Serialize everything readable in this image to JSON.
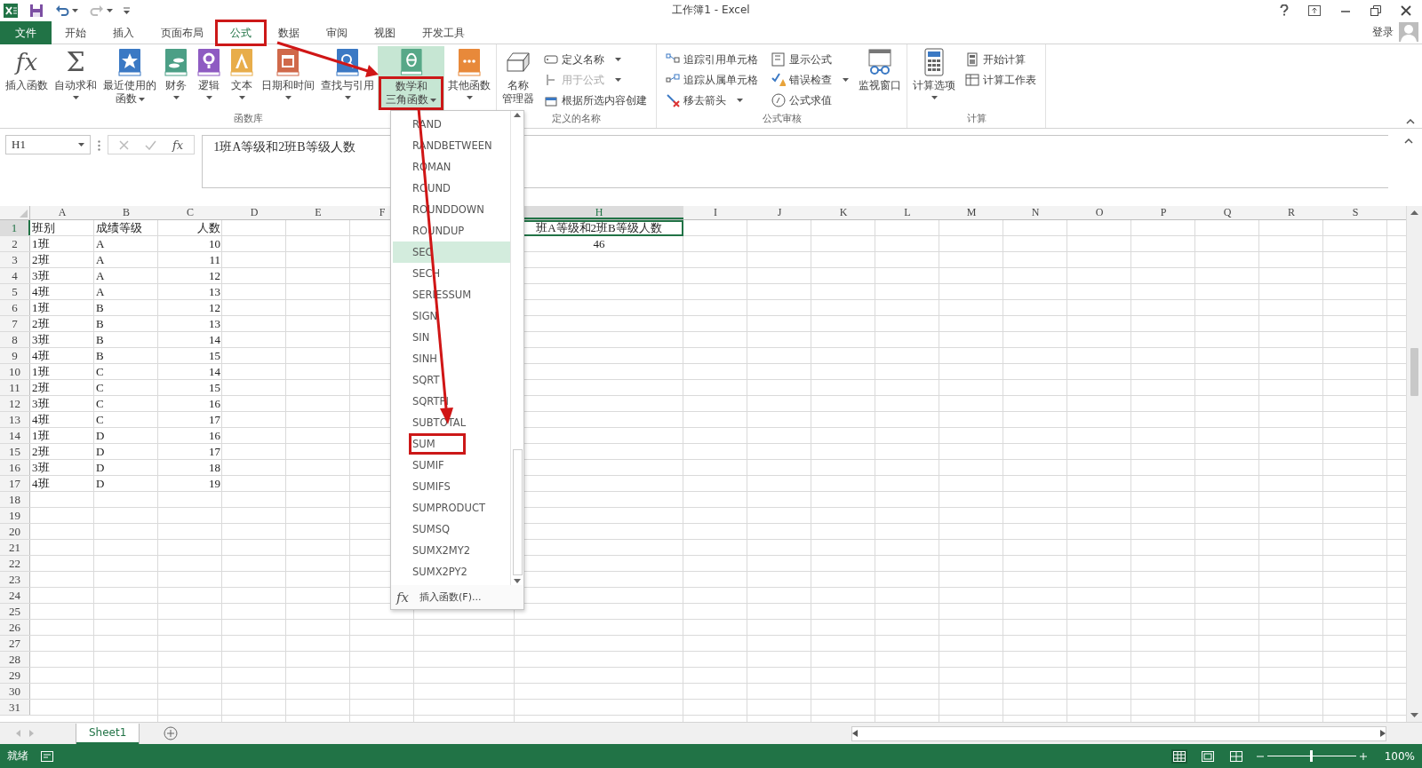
{
  "title_bar": {
    "title": "工作簿1 - Excel",
    "redo": {
      "disabled": true
    }
  },
  "tabs": [
    {
      "label": "文件",
      "kind": "file",
      "selected": false,
      "annotated": false
    },
    {
      "label": "开始",
      "kind": "tab",
      "selected": false,
      "annotated": false
    },
    {
      "label": "插入",
      "kind": "tab",
      "selected": false,
      "annotated": false
    },
    {
      "label": "页面布局",
      "kind": "tab",
      "selected": false,
      "annotated": false
    },
    {
      "label": "公式",
      "kind": "tab",
      "selected": true,
      "annotated": true
    },
    {
      "label": "数据",
      "kind": "tab",
      "selected": false,
      "annotated": false
    },
    {
      "label": "审阅",
      "kind": "tab",
      "selected": false,
      "annotated": false
    },
    {
      "label": "视图",
      "kind": "tab",
      "selected": false,
      "annotated": false
    },
    {
      "label": "开发工具",
      "kind": "tab",
      "selected": false,
      "annotated": false
    }
  ],
  "account": {
    "label": "登录"
  },
  "ribbon": {
    "groups": [
      {
        "label": "函数库",
        "items": [
          {
            "kind": "large",
            "icon_text": "fx",
            "lines": [
              "插入函数"
            ],
            "dropdown": false,
            "selected": false,
            "annotated": false
          },
          {
            "kind": "large",
            "icon_text": "Σ",
            "lines": [
              "自动求和"
            ],
            "dropdown": true,
            "selected": false,
            "annotated": false
          },
          {
            "kind": "large",
            "lines": [
              "最近使用的",
              "函数"
            ],
            "dropdown": true,
            "selected": false,
            "annotated": false
          },
          {
            "kind": "large",
            "lines": [
              "财务"
            ],
            "dropdown": true,
            "selected": false,
            "annotated": false
          },
          {
            "kind": "large",
            "lines": [
              "逻辑"
            ],
            "dropdown": true,
            "selected": false,
            "annotated": false
          },
          {
            "kind": "large",
            "lines": [
              "文本"
            ],
            "dropdown": true,
            "selected": false,
            "annotated": false
          },
          {
            "kind": "large",
            "lines": [
              "日期和时间"
            ],
            "dropdown": true,
            "selected": false,
            "annotated": false
          },
          {
            "kind": "large",
            "lines": [
              "查找与引用"
            ],
            "dropdown": true,
            "selected": false,
            "annotated": false
          },
          {
            "kind": "large",
            "lines": [
              "数学和",
              "三角函数"
            ],
            "dropdown": true,
            "selected": true,
            "annotated": true
          },
          {
            "kind": "large",
            "lines": [
              "其他函数"
            ],
            "dropdown": true,
            "selected": false,
            "annotated": false
          }
        ]
      },
      {
        "label": "定义的名称",
        "items": [
          {
            "kind": "large",
            "lines": [
              "名称",
              "管理器"
            ],
            "dropdown": false,
            "selected": false,
            "annotated": false
          },
          {
            "kind": "column",
            "items": [
              {
                "label": "定义名称",
                "dropdown": true,
                "disabled": false
              },
              {
                "label": "用于公式",
                "dropdown": true,
                "disabled": true
              },
              {
                "label": "根据所选内容创建",
                "dropdown": false,
                "disabled": false
              }
            ]
          }
        ]
      },
      {
        "label": "公式审核",
        "items": [
          {
            "kind": "column",
            "items": [
              {
                "label": "追踪引用单元格",
                "dropdown": false,
                "disabled": false
              },
              {
                "label": "追踪从属单元格",
                "dropdown": false,
                "disabled": false
              },
              {
                "label": "移去箭头",
                "dropdown": true,
                "disabled": false
              }
            ]
          },
          {
            "kind": "column",
            "items": [
              {
                "label": "显示公式",
                "dropdown": false,
                "disabled": false
              },
              {
                "label": "错误检查",
                "dropdown": true,
                "disabled": false
              },
              {
                "label": "公式求值",
                "dropdown": false,
                "disabled": false
              }
            ]
          },
          {
            "kind": "large",
            "lines": [
              "监视窗口"
            ],
            "dropdown": false,
            "selected": false,
            "annotated": false
          }
        ]
      },
      {
        "label": "计算",
        "items": [
          {
            "kind": "large",
            "lines": [
              "计算选项"
            ],
            "dropdown": true,
            "selected": false,
            "annotated": false
          },
          {
            "kind": "column",
            "items": [
              {
                "label": "开始计算",
                "dropdown": false,
                "disabled": false
              },
              {
                "label": "计算工作表",
                "dropdown": false,
                "disabled": false
              }
            ]
          }
        ]
      }
    ]
  },
  "formula_bar": {
    "name_box": "H1",
    "buttons_disabled": true,
    "fx": "fx",
    "formula": "1班A等级和2班B等级人数"
  },
  "grid": {
    "columns": [
      {
        "label": "A",
        "selected": false
      },
      {
        "label": "B",
        "selected": false
      },
      {
        "label": "C",
        "selected": false
      },
      {
        "label": "D",
        "selected": false
      },
      {
        "label": "E",
        "selected": false
      },
      {
        "label": "F",
        "selected": false
      },
      {},
      {
        "label": "H",
        "selected": true
      },
      {
        "label": "I",
        "selected": false
      },
      {
        "label": "J",
        "selected": false
      },
      {
        "label": "K",
        "selected": false
      },
      {
        "label": "L",
        "selected": false
      },
      {
        "label": "M",
        "selected": false
      },
      {
        "label": "N",
        "selected": false
      },
      {
        "label": "O",
        "selected": false
      },
      {
        "label": "P",
        "selected": false
      },
      {
        "label": "Q",
        "selected": false
      },
      {
        "label": "R",
        "selected": false
      },
      {
        "label": "S",
        "selected": false
      }
    ],
    "rows": [
      {
        "label": "1",
        "selected": true,
        "cells": [
          "班别",
          "成绩等级",
          "人数",
          null,
          null,
          null,
          null,
          "班A等级和2班B等级人数"
        ]
      },
      {
        "label": "2",
        "selected": false,
        "cells": [
          "1班",
          "A",
          "10",
          null,
          null,
          null,
          null,
          "46"
        ]
      },
      {
        "label": "3",
        "selected": false,
        "cells": [
          "2班",
          "A",
          "11"
        ]
      },
      {
        "label": "4",
        "selected": false,
        "cells": [
          "3班",
          "A",
          "12"
        ]
      },
      {
        "label": "5",
        "selected": false,
        "cells": [
          "4班",
          "A",
          "13"
        ]
      },
      {
        "label": "6",
        "selected": false,
        "cells": [
          "1班",
          "B",
          "12"
        ]
      },
      {
        "label": "7",
        "selected": false,
        "cells": [
          "2班",
          "B",
          "13"
        ]
      },
      {
        "label": "8",
        "selected": false,
        "cells": [
          "3班",
          "B",
          "14"
        ]
      },
      {
        "label": "9",
        "selected": false,
        "cells": [
          "4班",
          "B",
          "15"
        ]
      },
      {
        "label": "10",
        "selected": false,
        "cells": [
          "1班",
          "C",
          "14"
        ]
      },
      {
        "label": "11",
        "selected": false,
        "cells": [
          "2班",
          "C",
          "15"
        ]
      },
      {
        "label": "12",
        "selected": false,
        "cells": [
          "3班",
          "C",
          "16"
        ]
      },
      {
        "label": "13",
        "selected": false,
        "cells": [
          "4班",
          "C",
          "17"
        ]
      },
      {
        "label": "14",
        "selected": false,
        "cells": [
          "1班",
          "D",
          "16"
        ]
      },
      {
        "label": "15",
        "selected": false,
        "cells": [
          "2班",
          "D",
          "17"
        ]
      },
      {
        "label": "16",
        "selected": false,
        "cells": [
          "3班",
          "D",
          "18"
        ]
      },
      {
        "label": "17",
        "selected": false,
        "cells": [
          "4班",
          "D",
          "19"
        ]
      },
      {
        "label": "18",
        "selected": false
      },
      {
        "label": "19",
        "selected": false
      },
      {
        "label": "20",
        "selected": false
      },
      {
        "label": "21",
        "selected": false
      },
      {
        "label": "22",
        "selected": false
      },
      {
        "label": "23",
        "selected": false
      },
      {
        "label": "24",
        "selected": false
      },
      {
        "label": "25",
        "selected": false
      },
      {
        "label": "26",
        "selected": false
      },
      {
        "label": "27",
        "selected": false
      },
      {
        "label": "28",
        "selected": false
      },
      {
        "label": "29",
        "selected": false
      },
      {
        "label": "30",
        "selected": false
      },
      {
        "label": "31",
        "selected": false
      }
    ]
  },
  "dropdown": {
    "items": [
      {
        "label": "RAND",
        "selected": false,
        "annotated": false
      },
      {
        "label": "RANDBETWEEN",
        "selected": false,
        "annotated": false
      },
      {
        "label": "ROMAN",
        "selected": false,
        "annotated": false
      },
      {
        "label": "ROUND",
        "selected": false,
        "annotated": false
      },
      {
        "label": "ROUNDDOWN",
        "selected": false,
        "annotated": false
      },
      {
        "label": "ROUNDUP",
        "selected": false,
        "annotated": false
      },
      {
        "label": "SEC",
        "selected": true,
        "annotated": false
      },
      {
        "label": "SECH",
        "selected": false,
        "annotated": false
      },
      {
        "label": "SERIESSUM",
        "selected": false,
        "annotated": false
      },
      {
        "label": "SIGN",
        "selected": false,
        "annotated": false
      },
      {
        "label": "SIN",
        "selected": false,
        "annotated": false
      },
      {
        "label": "SINH",
        "selected": false,
        "annotated": false
      },
      {
        "label": "SQRT",
        "selected": false,
        "annotated": false
      },
      {
        "label": "SQRTPI",
        "selected": false,
        "annotated": false
      },
      {
        "label": "SUBTOTAL",
        "selected": false,
        "annotated": false
      },
      {
        "label": "SUM",
        "selected": false,
        "annotated": true
      },
      {
        "label": "SUMIF",
        "selected": false,
        "annotated": false
      },
      {
        "label": "SUMIFS",
        "selected": false,
        "annotated": false
      },
      {
        "label": "SUMPRODUCT",
        "selected": false,
        "annotated": false
      },
      {
        "label": "SUMSQ",
        "selected": false,
        "annotated": false
      },
      {
        "label": "SUMX2MY2",
        "selected": false,
        "annotated": false
      },
      {
        "label": "SUMX2PY2",
        "selected": false,
        "annotated": false
      }
    ],
    "footer": {
      "icon_text": "fx",
      "label": "插入函数(F)..."
    }
  },
  "sheet_tabs": [
    {
      "label": "Sheet1",
      "selected": true
    }
  ],
  "status_bar": {
    "status": "就绪",
    "views": [
      {
        "selected": true
      },
      {
        "selected": false
      },
      {
        "selected": false
      }
    ],
    "zoom": {
      "level": 0.5,
      "reading": "100%"
    }
  }
}
